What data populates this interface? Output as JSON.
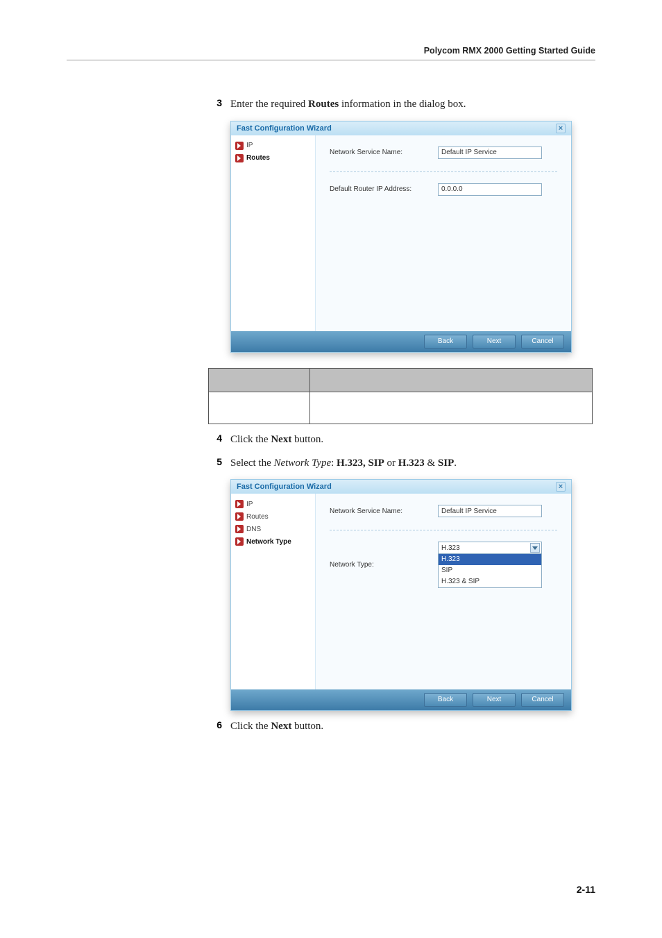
{
  "header": {
    "breadcrumb": "Polycom RMX 2000 Getting Started Guide"
  },
  "steps": {
    "s3_num": "3",
    "s3_pre": "Enter the required ",
    "s3_b": "Routes",
    "s3_post": " information in the dialog box.",
    "s4_num": "4",
    "s4_pre": "Click the ",
    "s4_b": "Next",
    "s4_post": " button.",
    "s5_num": "5",
    "s5_pre": "Select the ",
    "s5_i": "Network Type",
    "s5_mid": ": ",
    "s5_b1": "H.323, SIP",
    "s5_mid2": " or ",
    "s5_b2": "H.323",
    "s5_amp": " & ",
    "s5_b3": "SIP",
    "s5_end": ".",
    "s6_num": "6",
    "s6_pre": "Click the ",
    "s6_b": "Next",
    "s6_post": " button."
  },
  "wiz1": {
    "title": "Fast Configuration Wizard",
    "side_ip": "IP",
    "side_routes": "Routes",
    "lbl_service": "Network Service Name:",
    "val_service": "Default IP Service",
    "lbl_router": "Default Router IP Address:",
    "val_router": "0.0.0.0",
    "btn_back": "Back",
    "btn_next": "Next",
    "btn_cancel": "Cancel"
  },
  "wiz2": {
    "title": "Fast Configuration Wizard",
    "side_ip": "IP",
    "side_routes": "Routes",
    "side_dns": "DNS",
    "side_nettype": "Network Type",
    "lbl_service": "Network Service Name:",
    "val_service": "Default IP Service",
    "lbl_nettype": "Network Type:",
    "sel_value": "H.323",
    "opt1": "H.323",
    "opt2": "SIP",
    "opt3": "H.323 & SIP",
    "btn_back": "Back",
    "btn_next": "Next",
    "btn_cancel": "Cancel"
  },
  "footer": {
    "page": "2-11"
  }
}
